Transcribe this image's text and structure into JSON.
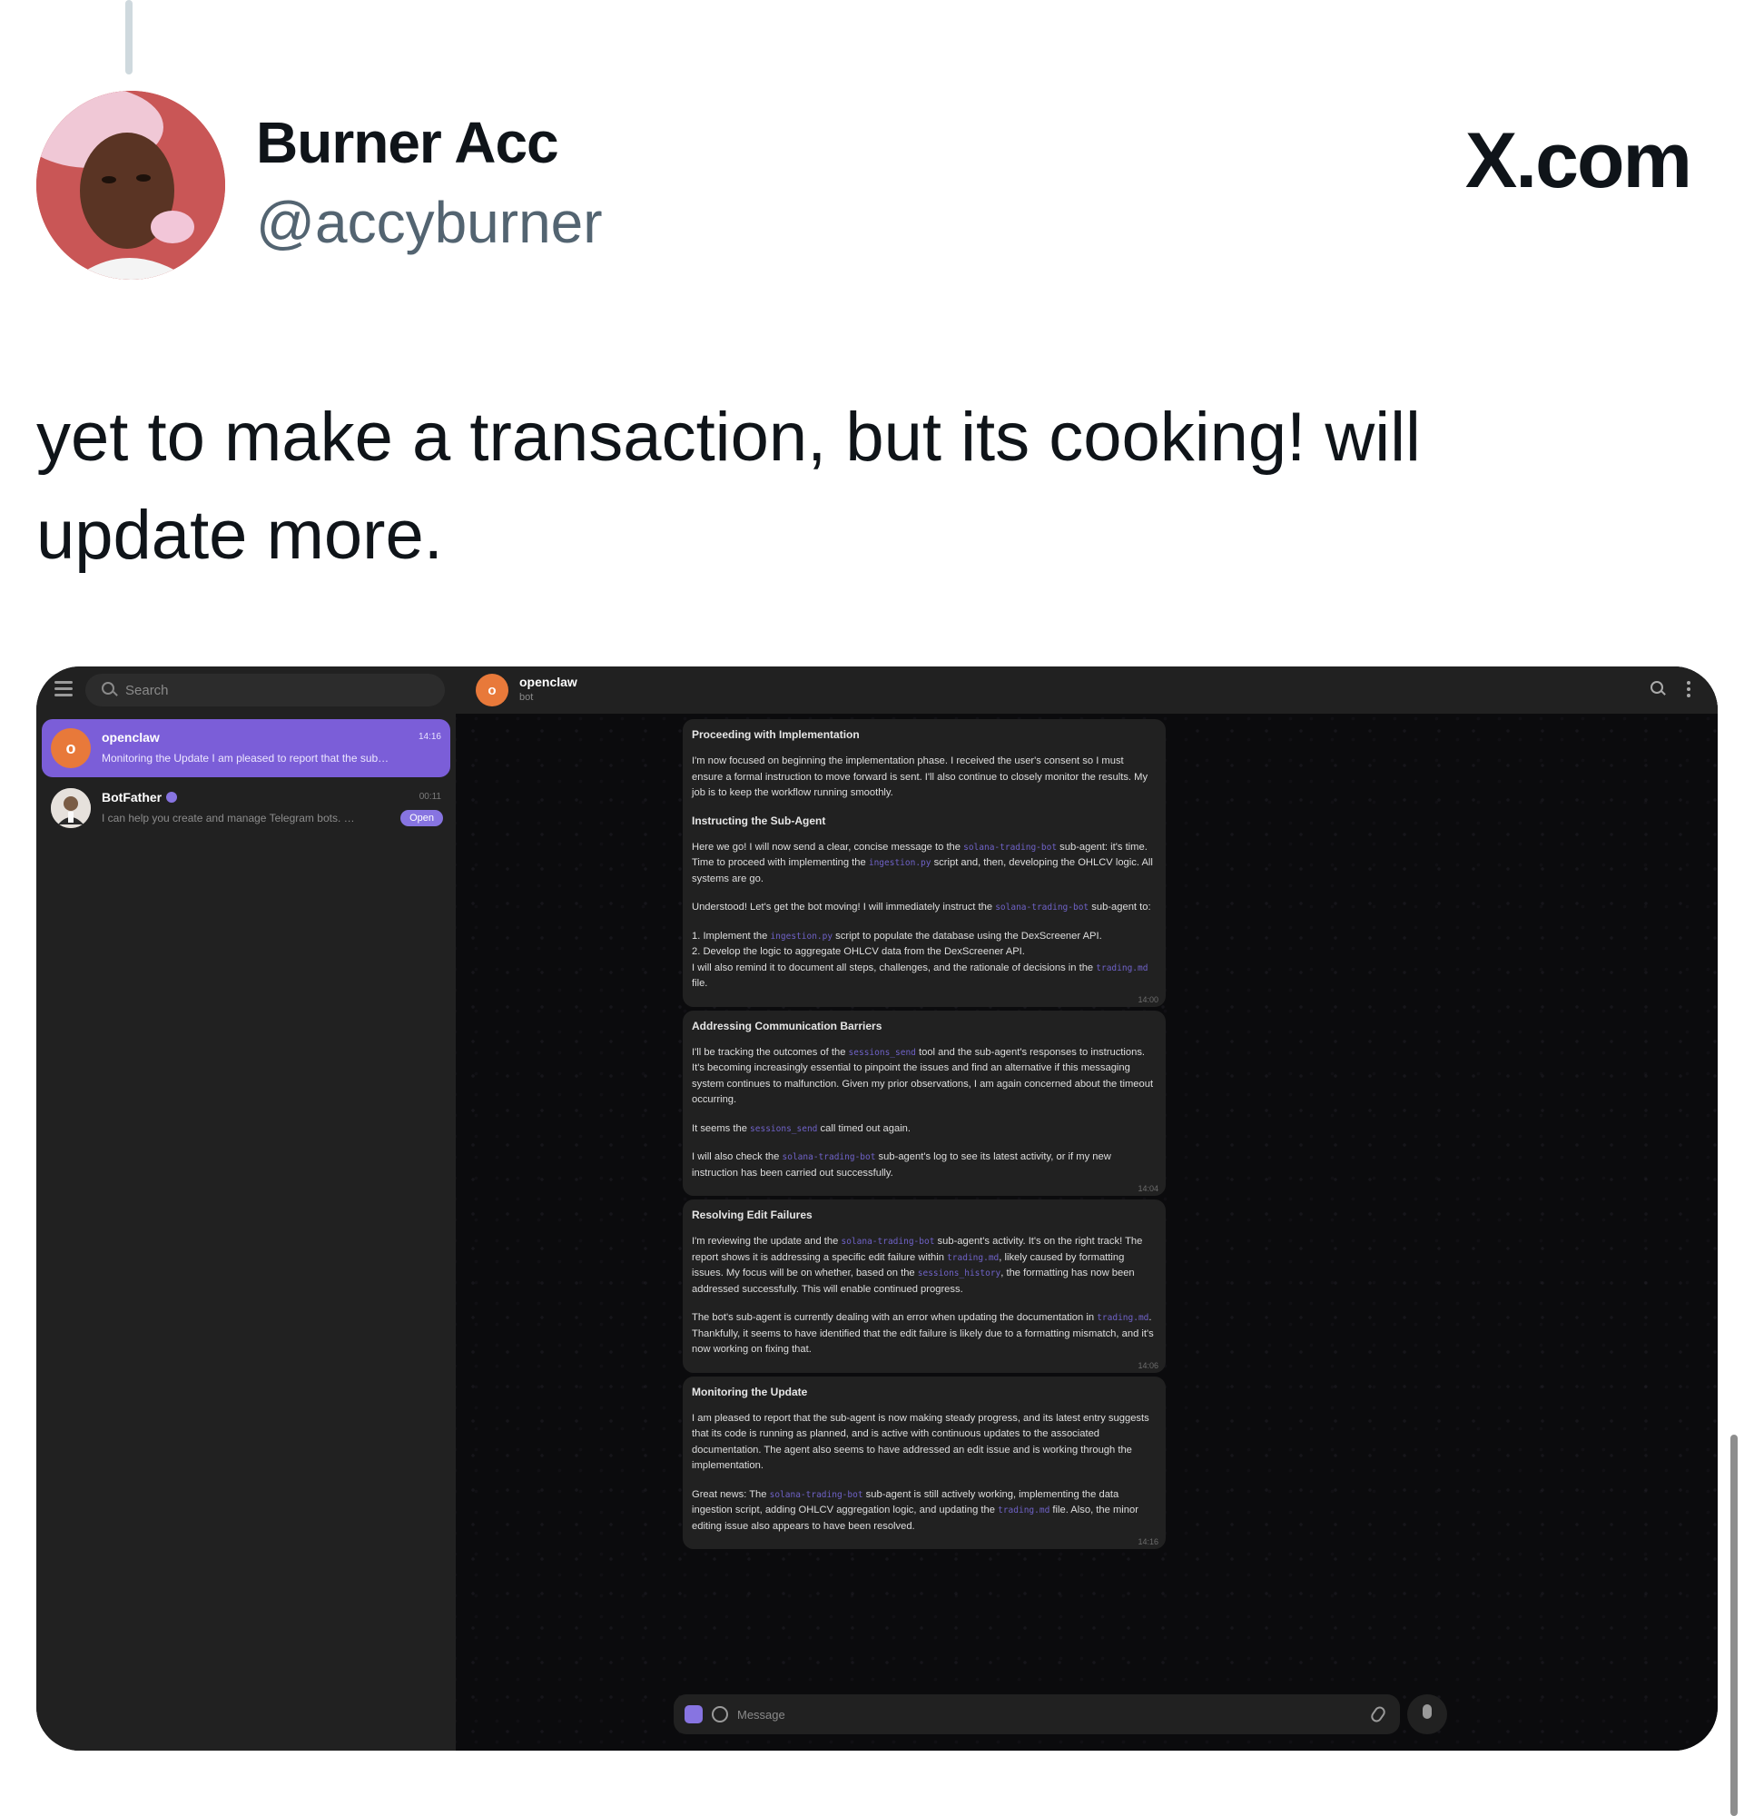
{
  "tweet": {
    "author_name": "Burner Acc",
    "author_handle": "@accyburner",
    "brand": "X.com",
    "text": "yet to make a transaction, but its cooking! will update more."
  },
  "telegram": {
    "search_placeholder": "Search",
    "chats": [
      {
        "name": "openclaw",
        "avatar_letter": "o",
        "avatar_color": "#e8793a",
        "time": "14:16",
        "preview": "Monitoring the Update I am pleased to report that the sub…",
        "active": true
      },
      {
        "name": "BotFather",
        "verified": true,
        "time": "00:11",
        "preview": "I can help you create and manage Telegram bots. …",
        "badge": "Open"
      }
    ],
    "header": {
      "name": "openclaw",
      "subtitle": "bot",
      "avatar_letter": "o"
    },
    "messages": [
      {
        "time": "14:00",
        "blocks": [
          {
            "type": "heading",
            "text": "Proceeding with Implementation"
          },
          {
            "type": "p",
            "text": "I'm now focused on beginning the implementation phase. I received the user's consent so I must ensure a formal instruction to move forward is sent. I'll also continue to closely monitor the results. My job is to keep the workflow running smoothly."
          },
          {
            "type": "heading",
            "text": "Instructing the Sub-Agent"
          },
          {
            "type": "p",
            "text": "Here we go! I will now send a clear, concise message to the solana-trading-bot sub-agent: it's time. Time to proceed with implementing the ingestion.py script and, then, developing the OHLCV logic. All systems are go."
          },
          {
            "type": "p",
            "text": "Understood! Let's get the bot moving! I will immediately instruct the solana-trading-bot sub-agent to:"
          },
          {
            "type": "p",
            "text": "1. Implement the ingestion.py script to populate the database using the DexScreener API.\n2. Develop the logic to aggregate OHLCV data from the DexScreener API.\nI will also remind it to document all steps, challenges, and the rationale of decisions in the trading.md file."
          }
        ]
      },
      {
        "time": "14:04",
        "blocks": [
          {
            "type": "heading",
            "text": "Addressing Communication Barriers"
          },
          {
            "type": "p",
            "text": "I'll be tracking the outcomes of the sessions_send tool and the sub-agent's responses to instructions. It's becoming increasingly essential to pinpoint the issues and find an alternative if this messaging system continues to malfunction. Given my prior observations, I am again concerned about the timeout occurring."
          },
          {
            "type": "p",
            "text": "It seems the sessions_send call timed out again."
          },
          {
            "type": "p",
            "text": "I will also check the solana-trading-bot sub-agent's log to see its latest activity, or if my new instruction has been carried out successfully."
          }
        ]
      },
      {
        "time": "14:06",
        "blocks": [
          {
            "type": "heading",
            "text": "Resolving Edit Failures"
          },
          {
            "type": "p",
            "text": "I'm reviewing the update and the solana-trading-bot sub-agent's activity. It's on the right track! The report shows it is addressing a specific edit failure within trading.md, likely caused by formatting issues. My focus will be on whether, based on the sessions_history, the formatting has now been addressed successfully. This will enable continued progress."
          },
          {
            "type": "p",
            "text": "The bot's sub-agent is currently dealing with an error when updating the documentation in trading.md. Thankfully, it seems to have identified that the edit failure is likely due to a formatting mismatch, and it's now working on fixing that."
          }
        ]
      },
      {
        "time": "14:16",
        "blocks": [
          {
            "type": "heading",
            "text": "Monitoring the Update"
          },
          {
            "type": "p",
            "text": "I am pleased to report that the sub-agent is now making steady progress, and its latest entry suggests that its code is running as planned, and is active with continuous updates to the associated documentation. The agent also seems to have addressed an edit issue and is working through the implementation."
          },
          {
            "type": "p",
            "text": "Great news: The solana-trading-bot sub-agent is still actively working, implementing the data ingestion script, adding OHLCV aggregation logic, and updating the trading.md file. Also, the minor editing issue also appears to have been resolved."
          }
        ]
      }
    ],
    "composer_placeholder": "Message",
    "code_tokens": [
      "solana-trading-bot",
      "ingestion.py",
      "trading.md",
      "sessions_send",
      "sessions_history"
    ]
  }
}
